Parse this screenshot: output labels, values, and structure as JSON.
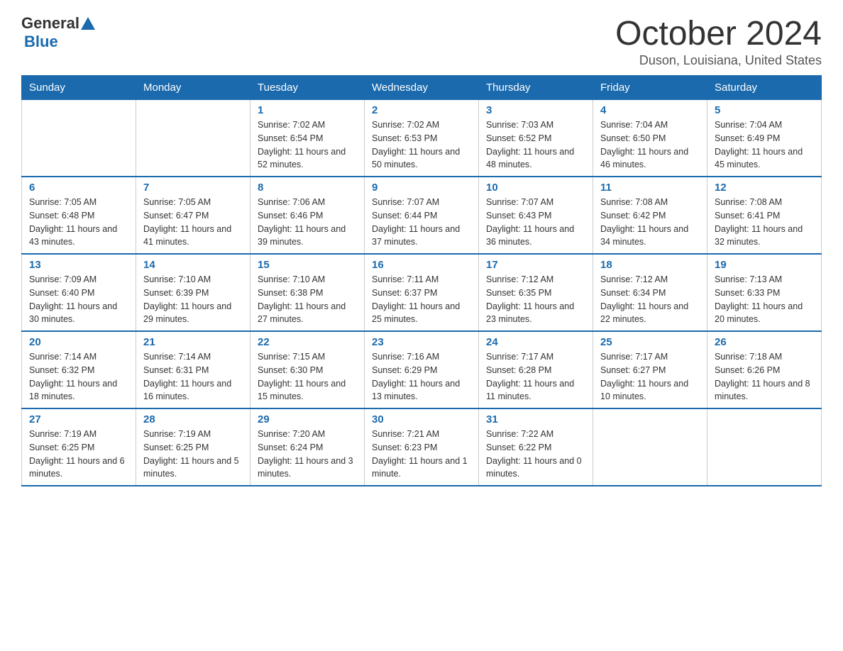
{
  "logo": {
    "general": "General",
    "blue": "Blue"
  },
  "title": "October 2024",
  "location": "Duson, Louisiana, United States",
  "weekdays": [
    "Sunday",
    "Monday",
    "Tuesday",
    "Wednesday",
    "Thursday",
    "Friday",
    "Saturday"
  ],
  "weeks": [
    [
      {
        "day": "",
        "info": ""
      },
      {
        "day": "",
        "info": ""
      },
      {
        "day": "1",
        "info": "Sunrise: 7:02 AM\nSunset: 6:54 PM\nDaylight: 11 hours and 52 minutes."
      },
      {
        "day": "2",
        "info": "Sunrise: 7:02 AM\nSunset: 6:53 PM\nDaylight: 11 hours and 50 minutes."
      },
      {
        "day": "3",
        "info": "Sunrise: 7:03 AM\nSunset: 6:52 PM\nDaylight: 11 hours and 48 minutes."
      },
      {
        "day": "4",
        "info": "Sunrise: 7:04 AM\nSunset: 6:50 PM\nDaylight: 11 hours and 46 minutes."
      },
      {
        "day": "5",
        "info": "Sunrise: 7:04 AM\nSunset: 6:49 PM\nDaylight: 11 hours and 45 minutes."
      }
    ],
    [
      {
        "day": "6",
        "info": "Sunrise: 7:05 AM\nSunset: 6:48 PM\nDaylight: 11 hours and 43 minutes."
      },
      {
        "day": "7",
        "info": "Sunrise: 7:05 AM\nSunset: 6:47 PM\nDaylight: 11 hours and 41 minutes."
      },
      {
        "day": "8",
        "info": "Sunrise: 7:06 AM\nSunset: 6:46 PM\nDaylight: 11 hours and 39 minutes."
      },
      {
        "day": "9",
        "info": "Sunrise: 7:07 AM\nSunset: 6:44 PM\nDaylight: 11 hours and 37 minutes."
      },
      {
        "day": "10",
        "info": "Sunrise: 7:07 AM\nSunset: 6:43 PM\nDaylight: 11 hours and 36 minutes."
      },
      {
        "day": "11",
        "info": "Sunrise: 7:08 AM\nSunset: 6:42 PM\nDaylight: 11 hours and 34 minutes."
      },
      {
        "day": "12",
        "info": "Sunrise: 7:08 AM\nSunset: 6:41 PM\nDaylight: 11 hours and 32 minutes."
      }
    ],
    [
      {
        "day": "13",
        "info": "Sunrise: 7:09 AM\nSunset: 6:40 PM\nDaylight: 11 hours and 30 minutes."
      },
      {
        "day": "14",
        "info": "Sunrise: 7:10 AM\nSunset: 6:39 PM\nDaylight: 11 hours and 29 minutes."
      },
      {
        "day": "15",
        "info": "Sunrise: 7:10 AM\nSunset: 6:38 PM\nDaylight: 11 hours and 27 minutes."
      },
      {
        "day": "16",
        "info": "Sunrise: 7:11 AM\nSunset: 6:37 PM\nDaylight: 11 hours and 25 minutes."
      },
      {
        "day": "17",
        "info": "Sunrise: 7:12 AM\nSunset: 6:35 PM\nDaylight: 11 hours and 23 minutes."
      },
      {
        "day": "18",
        "info": "Sunrise: 7:12 AM\nSunset: 6:34 PM\nDaylight: 11 hours and 22 minutes."
      },
      {
        "day": "19",
        "info": "Sunrise: 7:13 AM\nSunset: 6:33 PM\nDaylight: 11 hours and 20 minutes."
      }
    ],
    [
      {
        "day": "20",
        "info": "Sunrise: 7:14 AM\nSunset: 6:32 PM\nDaylight: 11 hours and 18 minutes."
      },
      {
        "day": "21",
        "info": "Sunrise: 7:14 AM\nSunset: 6:31 PM\nDaylight: 11 hours and 16 minutes."
      },
      {
        "day": "22",
        "info": "Sunrise: 7:15 AM\nSunset: 6:30 PM\nDaylight: 11 hours and 15 minutes."
      },
      {
        "day": "23",
        "info": "Sunrise: 7:16 AM\nSunset: 6:29 PM\nDaylight: 11 hours and 13 minutes."
      },
      {
        "day": "24",
        "info": "Sunrise: 7:17 AM\nSunset: 6:28 PM\nDaylight: 11 hours and 11 minutes."
      },
      {
        "day": "25",
        "info": "Sunrise: 7:17 AM\nSunset: 6:27 PM\nDaylight: 11 hours and 10 minutes."
      },
      {
        "day": "26",
        "info": "Sunrise: 7:18 AM\nSunset: 6:26 PM\nDaylight: 11 hours and 8 minutes."
      }
    ],
    [
      {
        "day": "27",
        "info": "Sunrise: 7:19 AM\nSunset: 6:25 PM\nDaylight: 11 hours and 6 minutes."
      },
      {
        "day": "28",
        "info": "Sunrise: 7:19 AM\nSunset: 6:25 PM\nDaylight: 11 hours and 5 minutes."
      },
      {
        "day": "29",
        "info": "Sunrise: 7:20 AM\nSunset: 6:24 PM\nDaylight: 11 hours and 3 minutes."
      },
      {
        "day": "30",
        "info": "Sunrise: 7:21 AM\nSunset: 6:23 PM\nDaylight: 11 hours and 1 minute."
      },
      {
        "day": "31",
        "info": "Sunrise: 7:22 AM\nSunset: 6:22 PM\nDaylight: 11 hours and 0 minutes."
      },
      {
        "day": "",
        "info": ""
      },
      {
        "day": "",
        "info": ""
      }
    ]
  ]
}
